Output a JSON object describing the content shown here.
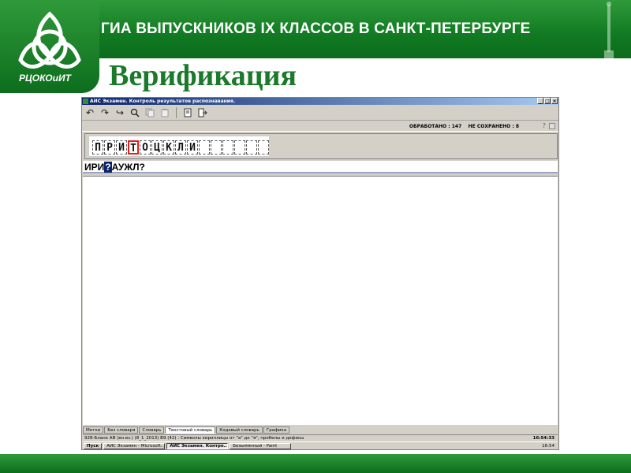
{
  "header": {
    "title": "ГИА ВЫПУСКНИКОВ IX КЛАССОВ В САНКТ-ПЕТЕРБУРГЕ",
    "logo_text": "РЦОКОиИТ",
    "slide_title": "Верификация"
  },
  "colors": {
    "brand_green": "#117a22",
    "title_green": "#1a7a2a",
    "win_bg": "#d4d0c8",
    "selection": "#0a246a",
    "marker_red": "#e02020"
  },
  "window": {
    "title": "АИС Экзамен. Контроль результатов распознавания.",
    "controls": [
      "_",
      "□",
      "×"
    ],
    "toolbar": [
      "undo-icon",
      "redo-icon",
      "redo-alt-icon",
      "search-icon",
      "copy-icon",
      "paste-icon",
      "document-icon",
      "exit-icon"
    ],
    "status": {
      "processed_label": "ОБРАБОТАНО : 147",
      "not_saved_label": "НЕ СОХРАНЕНО : 8",
      "help": "?"
    },
    "scan_chars": [
      "П",
      "Р",
      "И",
      "Т",
      "О",
      "Ц",
      "К",
      "Л",
      "И",
      "",
      "",
      "",
      "",
      "",
      ""
    ],
    "scan_selected_index": 3,
    "recognized_text": {
      "before": "ИРИ",
      "highlight": "?",
      "after": "АУЖЛ?"
    },
    "tabs": [
      "Метки",
      "Без словаря",
      "Словарь",
      "Текстовый словарь",
      "Кодовый словарь",
      "Графика"
    ],
    "active_tab": 3,
    "statusbar": {
      "text": "928-Бланк АВ (вн.вз.) (8_1_2013)   В9 (42) : Символы кириллицы от \"а\" до \"я\", пробелы и дефисы",
      "time": "16:54:33"
    },
    "taskbar": {
      "start": "Пуск",
      "items": [
        "АИС Экзамен - Microsoft...",
        "АИС Экзамен. Контро...",
        "Безымянный - Paint"
      ],
      "active_item": 1,
      "clock": "16:54"
    }
  }
}
